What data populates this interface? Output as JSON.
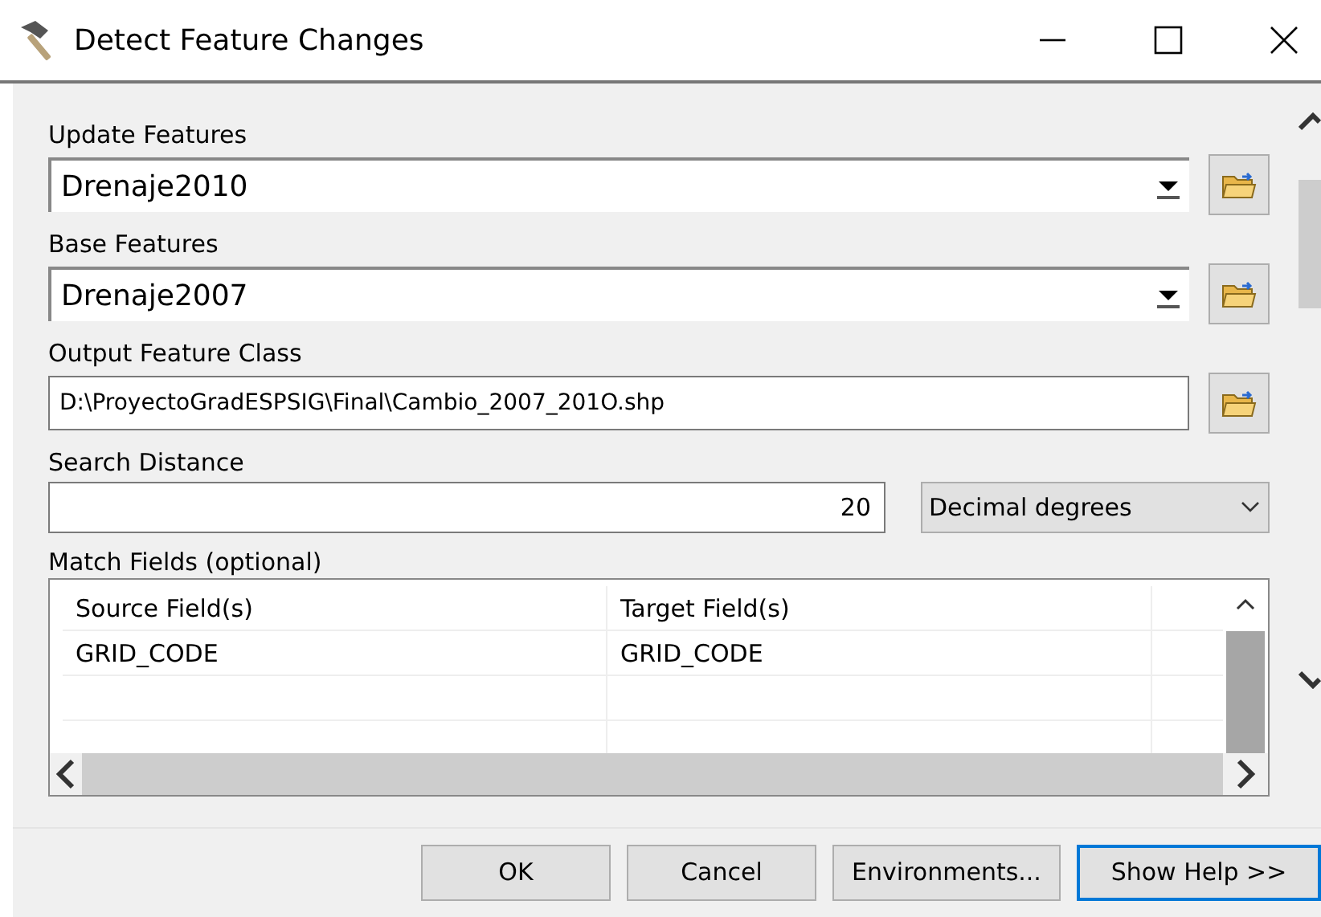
{
  "window": {
    "title": "Detect Feature Changes"
  },
  "fields": [
    {
      "kind": "combo",
      "label": "Update Features",
      "value": "Drenaje2010"
    },
    {
      "kind": "combo",
      "label": "Base Features",
      "value": "Drenaje2007"
    },
    {
      "kind": "path",
      "label": "Output Feature Class",
      "value": "D:\\ProyectoGradESPSIG\\Final\\Cambio_2007_201O.shp"
    },
    {
      "kind": "distance",
      "label": "Search Distance",
      "value": "20",
      "unit": "Decimal degrees"
    }
  ],
  "match_fields": {
    "label": "Match Fields (optional)",
    "columns": [
      "Source Field(s)",
      "Target Field(s)"
    ],
    "rows": [
      [
        "GRID_CODE",
        "GRID_CODE"
      ]
    ]
  },
  "buttons": [
    {
      "label": "OK",
      "focused": false
    },
    {
      "label": "Cancel",
      "focused": false
    },
    {
      "label": "Environments...",
      "focused": false
    },
    {
      "label": "Show Help >>",
      "focused": true
    }
  ]
}
